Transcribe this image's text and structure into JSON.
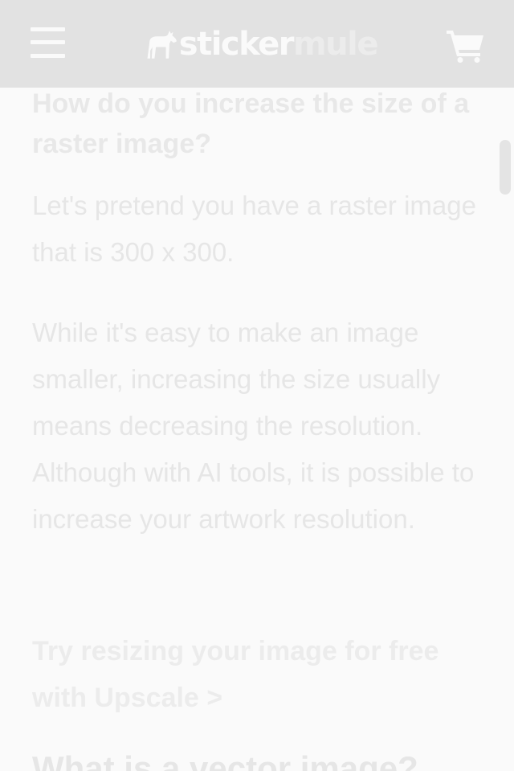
{
  "header": {
    "logo_sticker": "sticker",
    "logo_mule": "mule"
  },
  "article": {
    "heading": "How do you increase the size of a raster image?",
    "paragraph_1": "Let's pretend you have a raster image that is 300 x 300.",
    "paragraph_2": "While it's easy to make an image smaller, increasing the size usually means decreasing the resolution. Although with AI tools, it is possible to increase your artwork resolution.",
    "cta_link": "Try resizing your image for free with Upscale >",
    "next_heading": "What is a vector image?"
  },
  "colors": {
    "header_bg": "#e2e2e2",
    "page_bg": "#fafafa",
    "text_faded": "#e6e6e6"
  },
  "icons": [
    "hamburger-menu-icon",
    "mule-logo-icon",
    "shopping-cart-icon"
  ]
}
